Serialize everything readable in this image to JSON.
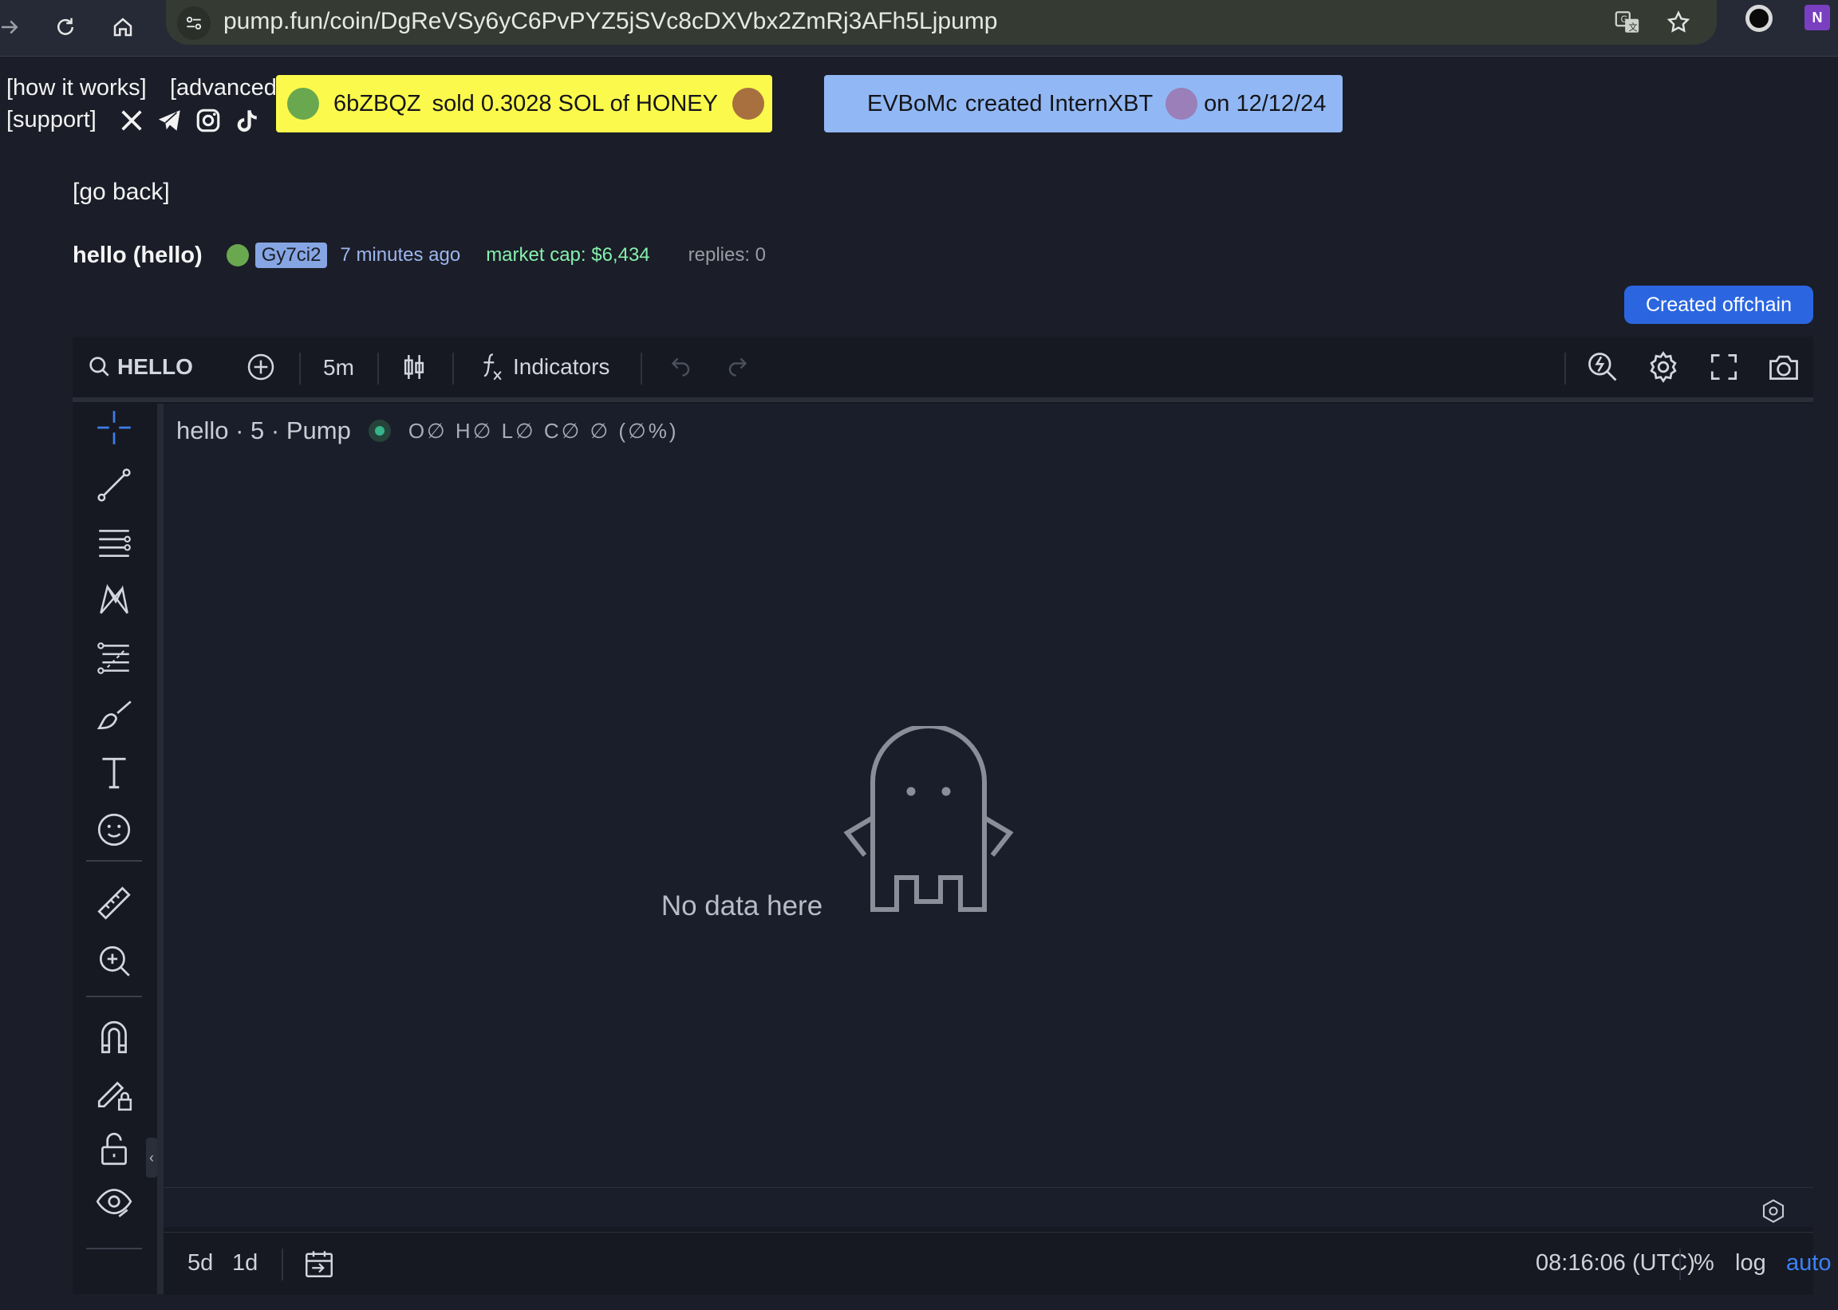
{
  "browser": {
    "url": "pump.fun/coin/DgReVSy6yC6PvPYZ5jSVc8cDXVbx2ZmRj3AFh5Ljpump",
    "icons": [
      "forward-icon",
      "reload-icon",
      "home-icon",
      "site-settings-icon",
      "translate-icon",
      "bookmark-star-icon",
      "extension-icon",
      "onenote-extension-icon"
    ]
  },
  "nav": {
    "how_it_works": "[how it works]",
    "advanced": "[advanced",
    "support": "[support]",
    "social_icons": [
      "x-icon",
      "telegram-icon",
      "instagram-icon",
      "tiktok-icon"
    ]
  },
  "ticker_trade": {
    "user": "6bZBQZ",
    "action": "sold 0.3028 SOL of HONEY",
    "color": "#fbfa4c"
  },
  "ticker_create": {
    "user": "EVBoMc",
    "action": "created InternXBT",
    "date": "on 12/12/24",
    "color": "#91b8f4"
  },
  "go_back": "[go back]",
  "coin": {
    "title": "hello (hello)",
    "creator": "Gy7ci2",
    "time_ago": "7 minutes ago",
    "market_cap": "market cap: $6,434",
    "replies": "replies: 0"
  },
  "offchain_button": "Created offchain",
  "chart_toolbar": {
    "symbol": "HELLO",
    "interval": "5m",
    "indicators": "Indicators",
    "icons": [
      "search-icon",
      "add-compare-icon",
      "candles-icon",
      "fx-icon",
      "undo-icon",
      "redo-icon",
      "quick-search-icon",
      "settings-icon",
      "fullscreen-icon",
      "snapshot-icon"
    ]
  },
  "left_tools": [
    "crosshair-icon",
    "trend-line-icon",
    "horizontal-lines-icon",
    "pattern-icon",
    "fib-icon",
    "brush-icon",
    "text-icon",
    "emoji-icon",
    "ruler-icon",
    "zoom-in-icon",
    "magnet-icon",
    "lock-drawing-icon",
    "lock-icon",
    "eye-icon"
  ],
  "legend": {
    "title": "hello · 5 · Pump",
    "ohlc": "O∅ H∅ L∅ C∅ ∅ (∅%)"
  },
  "empty_state": "No data here",
  "bottom_bar": {
    "range_5d": "5d",
    "range_1d": "1d",
    "time": "08:16:06 (UTC)",
    "percent": "%",
    "log": "log",
    "auto": "auto"
  },
  "colors": {
    "background": "#1b1d28",
    "accent_blue": "#2b66e0",
    "market_cap_green": "#86efac",
    "auto_blue": "#3b82f6"
  }
}
